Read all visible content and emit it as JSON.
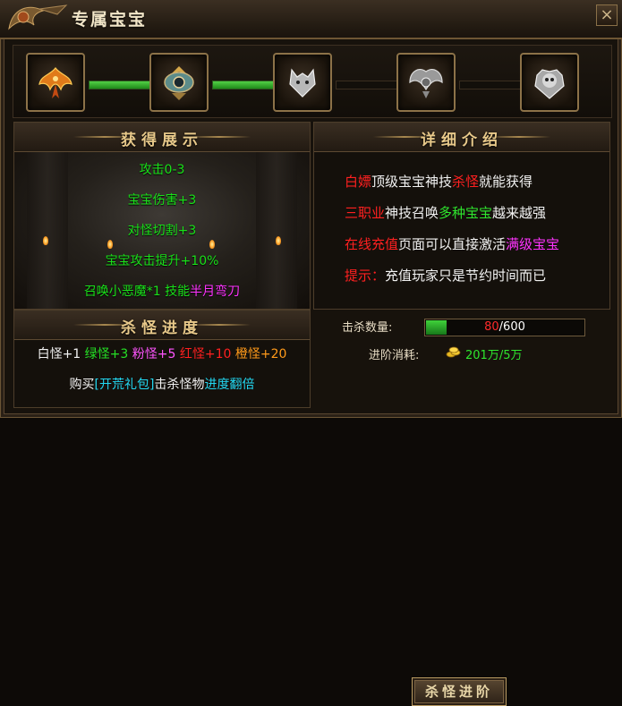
{
  "window": {
    "title": "专属宝宝",
    "close_label": "×"
  },
  "progression": {
    "nodes": [
      {
        "icon": "phoenix-emblem-icon",
        "unlocked": true
      },
      {
        "icon": "eye-emblem-icon",
        "unlocked": true
      },
      {
        "icon": "wolf-emblem-icon",
        "unlocked": false
      },
      {
        "icon": "wings-emblem-icon",
        "unlocked": false
      },
      {
        "icon": "skull-emblem-icon",
        "unlocked": false
      }
    ],
    "links_active": [
      true,
      true,
      false,
      false
    ]
  },
  "showcase": {
    "header": "获得展示",
    "stats": {
      "attack": "攻击0-3",
      "pet_damage": "宝宝伤害+3",
      "monster_cut": "对怪切割+3",
      "attack_boost": "宝宝攻击提升+10%",
      "summon_prefix": "召唤小恶魔*1   技能",
      "summon_skill": "半月弯刀"
    }
  },
  "details": {
    "header": "详细介绍",
    "line1": {
      "a": "白嫖",
      "b": "顶级宝宝神技",
      "c": "杀怪",
      "d": "就能获得"
    },
    "line2": {
      "a": "三职业",
      "b": "神技召唤",
      "c": "多种宝宝",
      "d": "越来越强"
    },
    "line3": {
      "a": "在线充值",
      "b": "页面可以直接激活",
      "c": "满级宝宝"
    },
    "line4": {
      "a": "提示：",
      "b": "充值玩家只是节约时间而已"
    }
  },
  "kill_progress": {
    "header": "杀怪进度",
    "rewards": {
      "white": "白怪+1",
      "green": "绿怪+3",
      "pink": "粉怪+5",
      "red": "红怪+10",
      "orange": "橙怪+20"
    },
    "bonus": {
      "a": "购买",
      "b": "[开荒礼包]",
      "c": "击杀怪物",
      "d": "进度翻倍"
    }
  },
  "advance": {
    "kill_count_label": "击杀数量:",
    "kill_current": "80",
    "kill_sep": "/",
    "kill_total": "600",
    "kill_fraction": 0.1333,
    "cost_label": "进阶消耗:",
    "cost_icon": "gold-coins-icon",
    "cost_value": "201万/5万",
    "button_label": "杀怪进阶"
  },
  "colors": {
    "green_text": "#19e019",
    "red_text": "#ff2020",
    "magenta_text": "#ff33ff",
    "header_gold": "#e8c98a",
    "progress_green": "#3fd23a"
  }
}
